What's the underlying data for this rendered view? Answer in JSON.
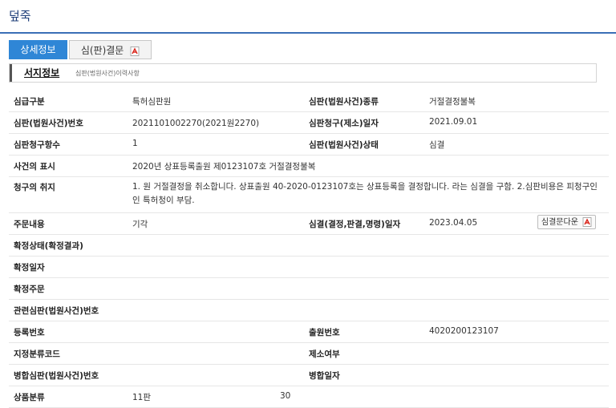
{
  "page": {
    "title": "덮죽"
  },
  "tabs": [
    {
      "label": "상세정보",
      "active": true
    },
    {
      "label": "심(판)결문",
      "active": false,
      "icon": "pdf-icon"
    }
  ],
  "subnav": {
    "title": "서지정보",
    "desc": "심판(법원사건)이력사항"
  },
  "rows": [
    {
      "label": "심급구분",
      "value": "특허심판원",
      "label2": "심판(법원사건)종류",
      "value2": "거절결정불복"
    },
    {
      "label": "심판(법원사건)번호",
      "value": "2021101002270(2021원2270)",
      "label2": "심판청구(제소)일자",
      "value2": "2021.09.01"
    },
    {
      "label": "심판청구항수",
      "value": "1",
      "label2": "심판(법원사건)상태",
      "value2": "심결"
    },
    {
      "label": "사건의 표시",
      "value": "2020년 상표등록출원 제0123107호 거절결정불복"
    },
    {
      "label": "청구의 취지",
      "value": "1. 원 거절결정을 취소합니다. 상표출원 40-2020-0123107호는 상표등록을 결정합니다. 라는 심결을 구함. 2.심판비용은 피청구인인 특허청이 부담."
    },
    {
      "label": "주문내용",
      "value": "기각",
      "label2": "심결(결정,판결,명령)일자",
      "value2": "2023.04.05",
      "button": "심결문다운"
    },
    {
      "label": "확정상태(확정결과)"
    },
    {
      "label": "확정일자"
    },
    {
      "label": "확정주문"
    },
    {
      "label": "관련심판(법원사건)번호"
    },
    {
      "label": "등록번호",
      "label2": "출원번호",
      "value2": "4020200123107"
    },
    {
      "label": "지정분류코드",
      "label2": "제소여부"
    },
    {
      "label": "병합심판(법원사건)번호",
      "label2": "병합일자"
    },
    {
      "label": "상품분류",
      "value": "11판",
      "extra": "30"
    }
  ],
  "colors": {
    "accent": "#2f86d6",
    "header_line": "#3b6fb6",
    "pdf": "#d9261c"
  }
}
